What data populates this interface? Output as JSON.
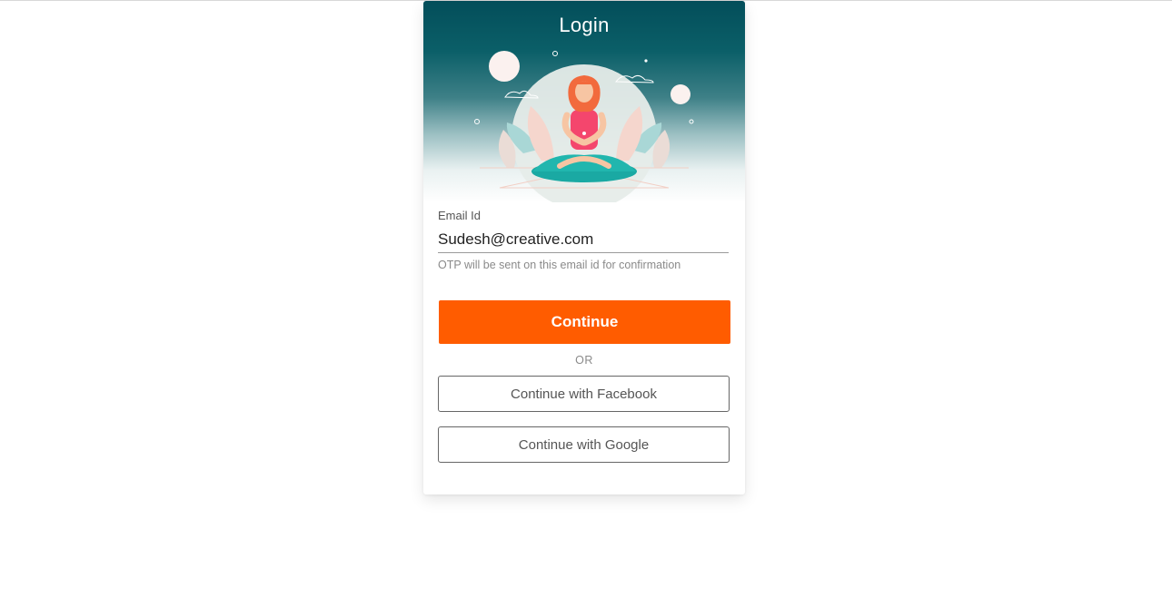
{
  "login": {
    "title": "Login",
    "email_label": "Email Id",
    "email_value": "Sudesh@creative.com",
    "helper_text": "OTP will be sent on this email id for confirmation",
    "continue_label": "Continue",
    "or_label": "OR",
    "facebook_label": "Continue with Facebook",
    "google_label": "Continue with Google"
  },
  "colors": {
    "header_teal": "#034e5a",
    "primary_orange": "#ff5c00"
  },
  "illustration": "woman-meditating-illustration"
}
